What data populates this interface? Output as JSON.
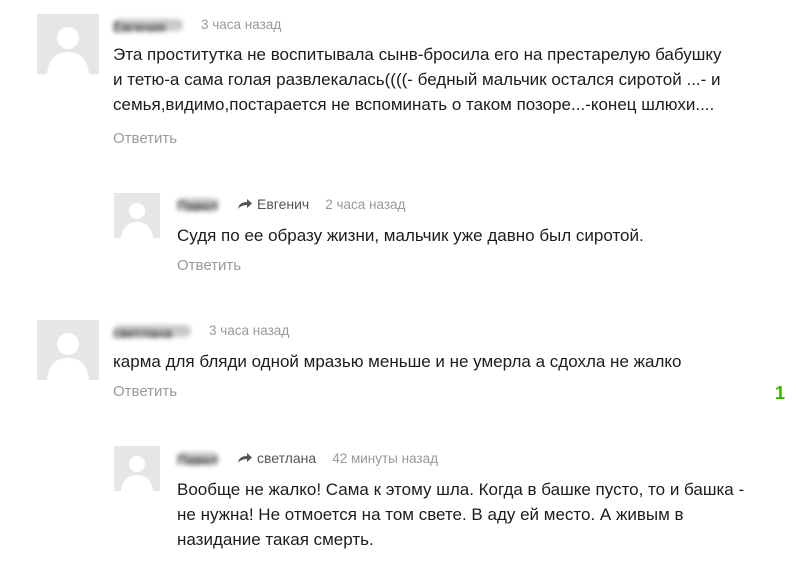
{
  "comments": [
    {
      "author": "Евгения",
      "time": "3 часа назад",
      "lines": [
        "Эта проститутка не воспитывала сынв-бросила его на престарелую бабушку",
        "и тетю-а сама голая развлекалась((((- бедный мальчик остался сиротой ...- и",
        "семья,видимо,постарается не вспоминать о таком позоре...-конец шлюхи...."
      ],
      "reply_label": "Ответить"
    },
    {
      "author": "Павел",
      "reply_to": "Евгенич",
      "time": "2 часа назад",
      "lines": [
        "Судя по ее образу жизни, мальчик уже давно был сиротой."
      ],
      "reply_label": "Ответить"
    },
    {
      "author": "светлана",
      "time": "3 часа назад",
      "lines": [
        "карма для бляди одной мразью меньше и не умерла а сдохла не жалко"
      ],
      "reply_label": "Ответить",
      "likes": "1"
    },
    {
      "author": "Павел",
      "reply_to": "светлана",
      "time": "42 минуты назад",
      "lines": [
        "Вообще не жалко! Сама к этому шла. Когда в башке пусто, то и башка -",
        "не нужна! Не отмоется на том свете. В аду ей место. А живым в",
        "назидание такая смерть."
      ]
    }
  ],
  "colors": {
    "likes": "#36b300",
    "muted": "#9a9a9a"
  }
}
